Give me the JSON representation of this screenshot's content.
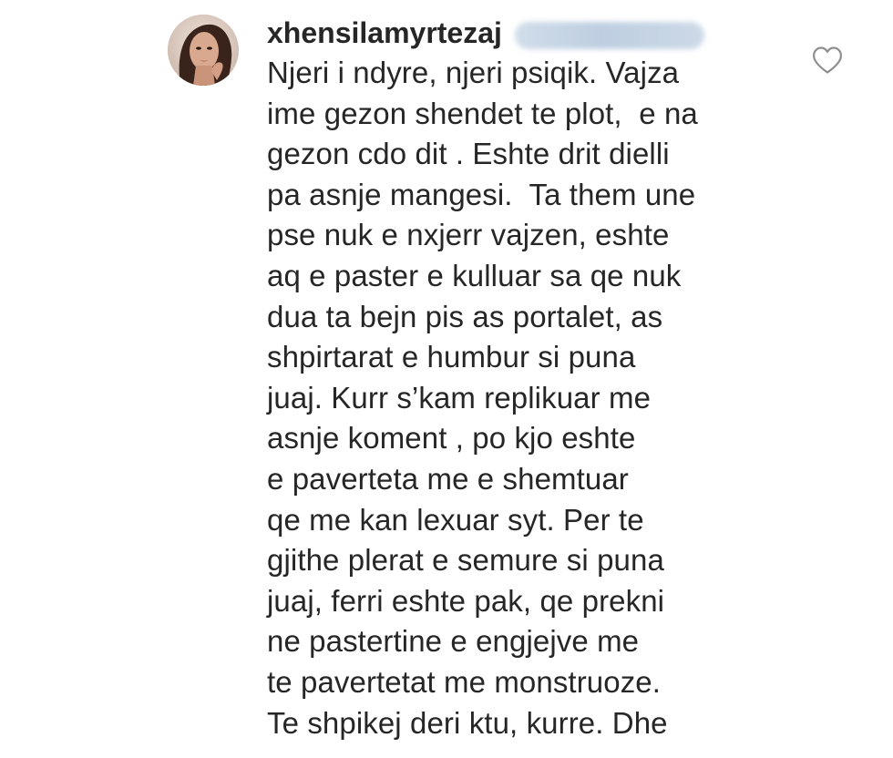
{
  "comment": {
    "username": "xhensilamyrtezaj",
    "lines": [
      "Njeri i ndyre, njeri psiqik. Vajza",
      "ime gezon shendet te plot,  e na",
      "gezon cdo dit . Eshte drit dielli",
      "pa asnje mangesi.  Ta them une",
      "pse nuk e nxjerr vajzen, eshte",
      "aq e paster e kulluar sa qe nuk",
      "dua ta bejn pis as portalet, as",
      "shpirtarat e humbur si puna",
      "juaj. Kurr s’kam replikuar me",
      "asnje koment , po kjo eshte",
      "e paverteta me e shemtuar",
      "qe me kan lexuar syt. Per te",
      "gjithe plerat e semure si puna",
      "juaj, ferri eshte pak, qe prekni",
      "ne pastertine e engjejve me",
      "te pavertetat me monstruoze.",
      "Te shpikej deri ktu, kurre. Dhe"
    ],
    "like_icon": "heart-outline-icon",
    "mention_blurred": true
  },
  "colors": {
    "text": "#262626",
    "icon": "#8e8e8e",
    "mention_blur": "#b3c6dc",
    "background": "#ffffff"
  }
}
